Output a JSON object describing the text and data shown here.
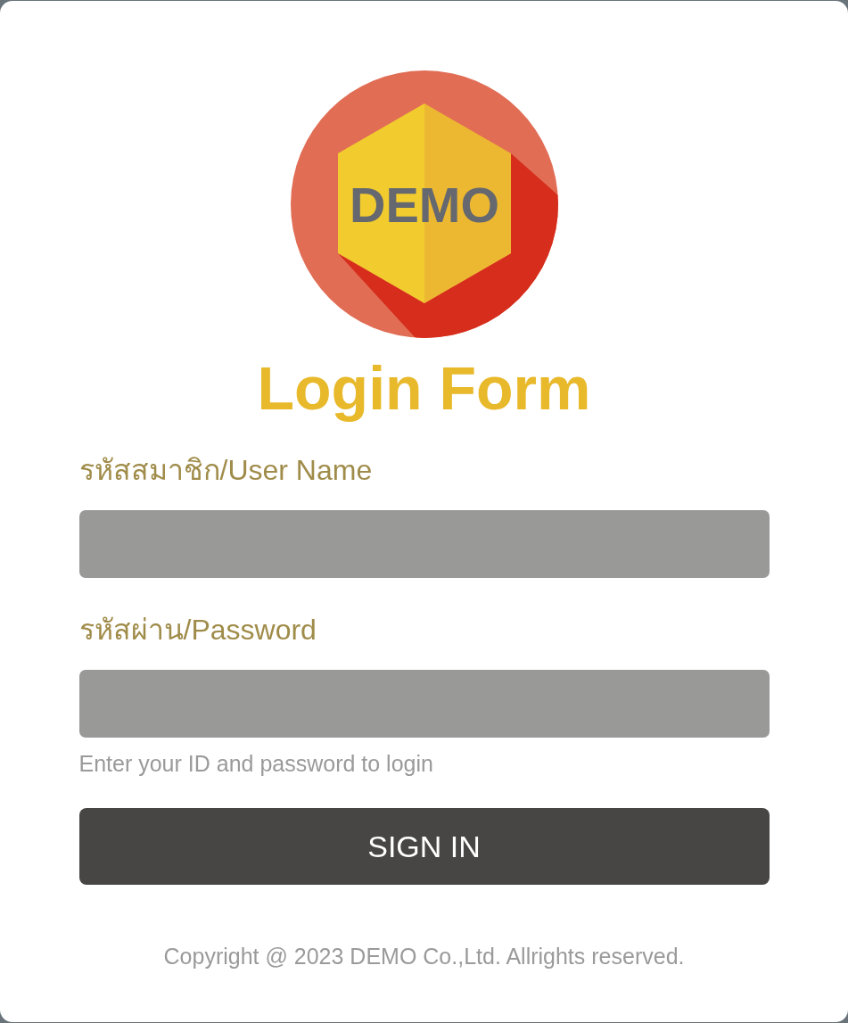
{
  "logo": {
    "text": "DEMO"
  },
  "title": "Login Form",
  "fields": [
    {
      "label": "รหัสสมาชิก/User Name"
    },
    {
      "label": "รหัสผ่าน/Password"
    }
  ],
  "hint": "Enter your ID and password to login",
  "button": "SIGN IN",
  "footer": "Copyright @ 2023 DEMO Co.,Ltd. Allrights reserved."
}
